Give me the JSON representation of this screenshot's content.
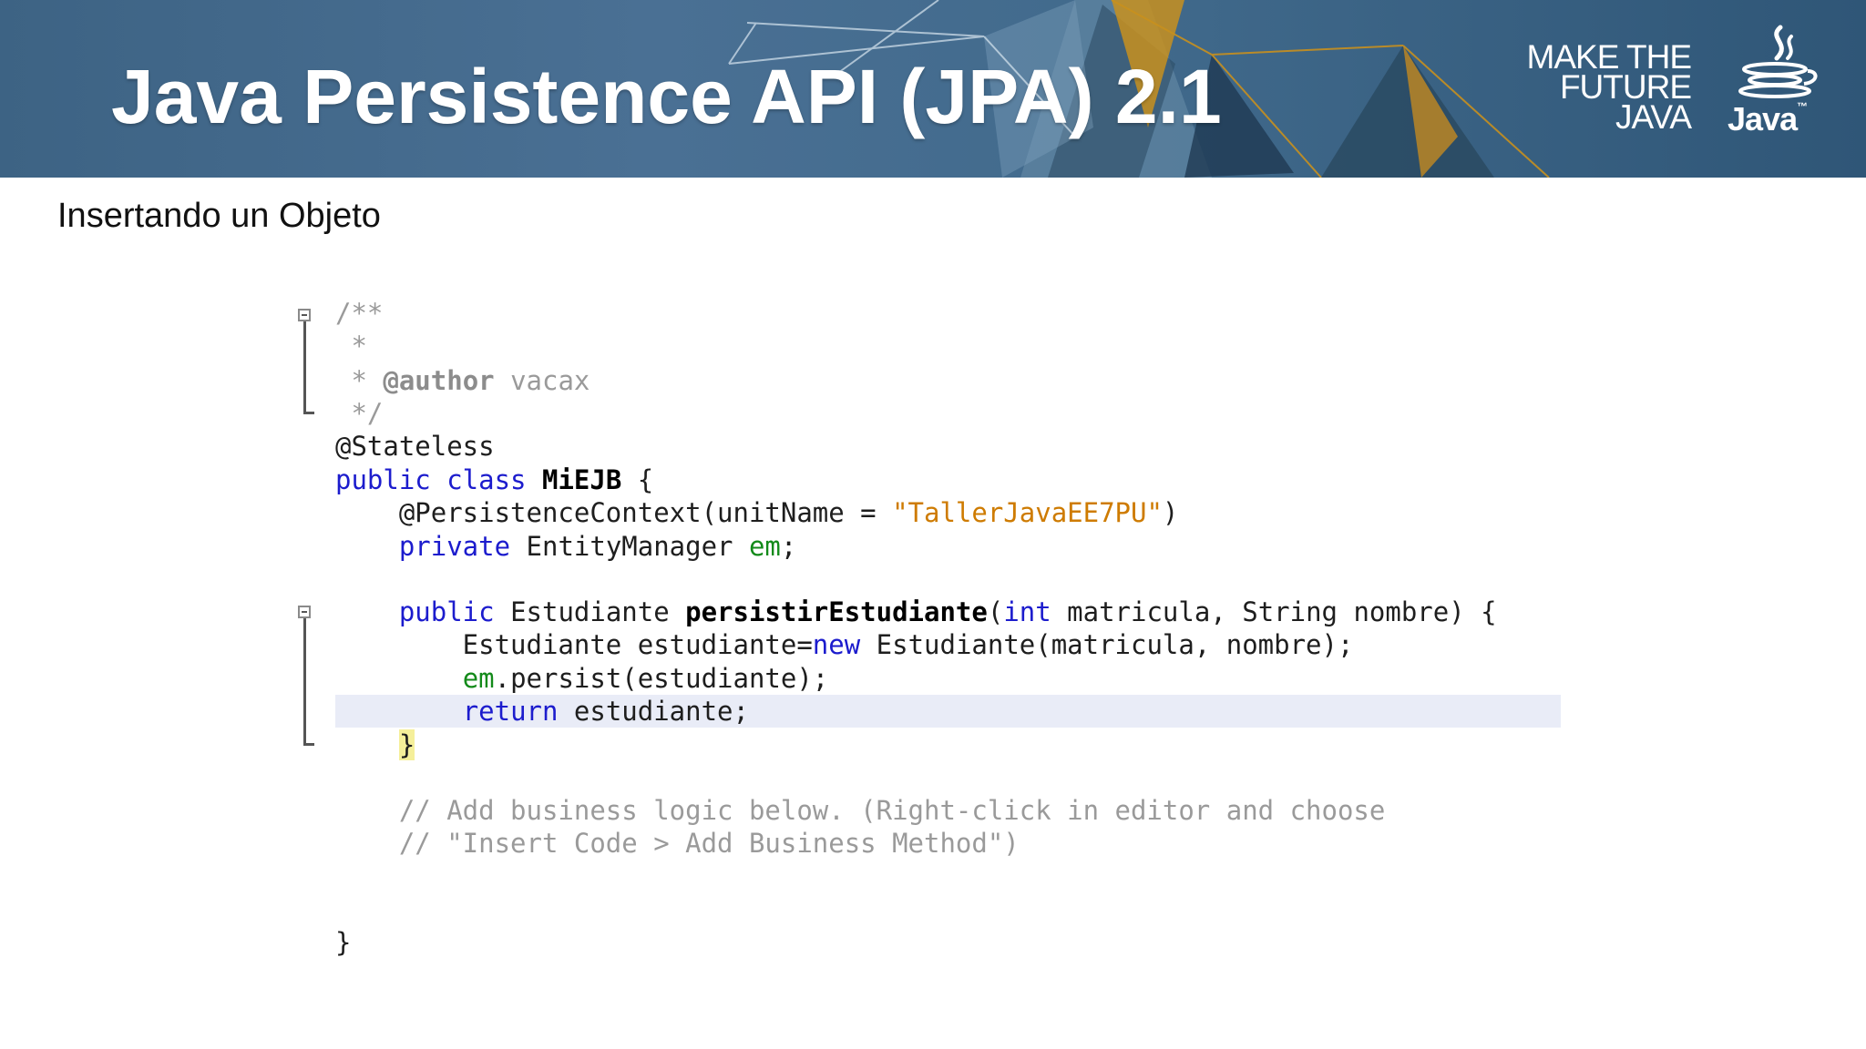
{
  "header": {
    "title": "Java Persistence API (JPA) 2.1",
    "tagline_lines": [
      "MAKE THE",
      "FUTURE",
      "JAVA"
    ],
    "logo_word": "Java",
    "logo_tm": "™"
  },
  "slide": {
    "subtitle": "Insertando un Objeto"
  },
  "code": {
    "l1": "/**",
    "l2": " *",
    "l3_star": " * ",
    "l3_tag": "@author",
    "l3_rest": " vacax",
    "l4": " */",
    "l5": "@Stateless",
    "l6_kw": "public class ",
    "l6_name": "MiEJB",
    "l6_rest": " {",
    "l7_a": "    @PersistenceContext(unitName = ",
    "l7_str": "\"TallerJavaEE7PU\"",
    "l7_b": ")",
    "l8_kw": "    private",
    "l8_a": " EntityManager ",
    "l8_fld": "em",
    "l8_b": ";",
    "l10_kw1": "    public",
    "l10_a": " Estudiante ",
    "l10_name": "persistirEstudiante",
    "l10_b": "(",
    "l10_kw2": "int",
    "l10_c": " matricula, String nombre) {",
    "l11_a": "        Estudiante estudiante=",
    "l11_kw": "new",
    "l11_b": " Estudiante(matricula, nombre);",
    "l12_indent": "        ",
    "l12_fld": "em",
    "l12_b": ".persist(estudiante);",
    "l13_indent": "        ",
    "l13_kw": "return",
    "l13_b": " estudiante;",
    "l14_indent": "    ",
    "l14_brace": "}",
    "l16": "    // Add business logic below. (Right-click in editor and choose",
    "l17": "    // \"Insert Code > Add Business Method\")",
    "l20": "}"
  },
  "colors": {
    "keyword": "#1c1ccd",
    "comment": "#9a9a9a",
    "string": "#ce7b00",
    "field": "#138a1a",
    "banner": "#416a8c"
  }
}
